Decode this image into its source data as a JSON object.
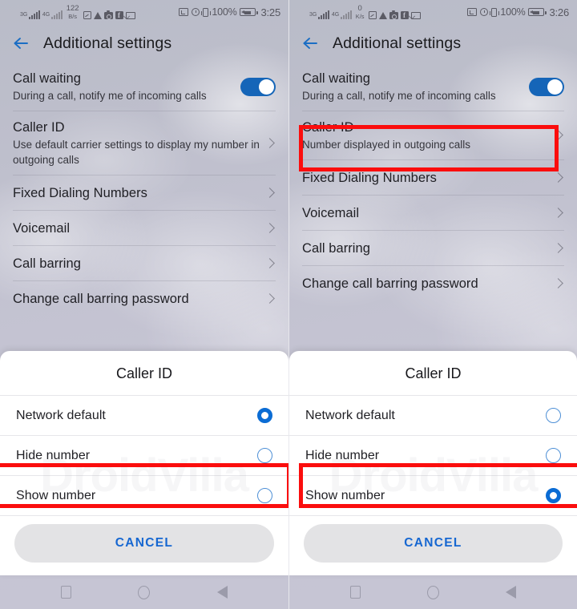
{
  "panels": [
    {
      "id": "left",
      "status_bar": {
        "signal1_gen": "3G",
        "signal2_gen": "4G",
        "net_speed_value": "122",
        "net_speed_unit": "B/s",
        "icons": [
          "screenshot-icon",
          "drive-icon",
          "camera-icon",
          "facebook-icon",
          "mail-icon"
        ],
        "cast_icon": "cast-icon",
        "alarm_icon": "alarm-icon",
        "vibrate_icon": "vibrate-icon",
        "battery_percent": "100%",
        "battery_icon": "battery-charging-icon",
        "clock": "3:25"
      },
      "appbar": {
        "back_icon": "back-arrow-icon",
        "title": "Additional settings"
      },
      "settings": [
        {
          "title": "Call waiting",
          "subtitle": "During a call, notify me of incoming calls",
          "control": "toggle",
          "toggle_on": true
        },
        {
          "title": "Caller ID",
          "subtitle": "Use default carrier settings to display my number in outgoing calls",
          "control": "chevron",
          "highlighted": false
        },
        {
          "title": "Fixed Dialing Numbers",
          "subtitle": "",
          "control": "chevron"
        },
        {
          "title": "Voicemail",
          "subtitle": "",
          "control": "chevron"
        },
        {
          "title": "Call barring",
          "subtitle": "",
          "control": "chevron"
        },
        {
          "title": "Change call barring password",
          "subtitle": "",
          "control": "chevron"
        }
      ],
      "dialog": {
        "title": "Caller ID",
        "options": [
          {
            "label": "Network default",
            "selected": true
          },
          {
            "label": "Hide number",
            "selected": false
          },
          {
            "label": "Show number",
            "selected": false
          }
        ],
        "cancel_label": "CANCEL",
        "highlight_option_index": 2
      },
      "watermark": "DroidVilla",
      "navbar": {
        "recents_icon": "square-recents-icon",
        "home_icon": "circle-home-icon",
        "back_icon": "triangle-back-icon"
      }
    },
    {
      "id": "right",
      "status_bar": {
        "signal1_gen": "3G",
        "signal2_gen": "4G",
        "net_speed_value": "0",
        "net_speed_unit": "K/s",
        "icons": [
          "screenshot-icon",
          "drive-icon",
          "camera-icon",
          "facebook-icon",
          "mail-icon"
        ],
        "cast_icon": "cast-icon",
        "alarm_icon": "alarm-icon",
        "vibrate_icon": "vibrate-icon",
        "battery_percent": "100%",
        "battery_icon": "battery-charging-icon",
        "clock": "3:26"
      },
      "appbar": {
        "back_icon": "back-arrow-icon",
        "title": "Additional settings"
      },
      "settings": [
        {
          "title": "Call waiting",
          "subtitle": "During a call, notify me of incoming calls",
          "control": "toggle",
          "toggle_on": true
        },
        {
          "title": "Caller ID",
          "subtitle": "Number displayed in outgoing calls",
          "control": "chevron",
          "highlighted": true
        },
        {
          "title": "Fixed Dialing Numbers",
          "subtitle": "",
          "control": "chevron"
        },
        {
          "title": "Voicemail",
          "subtitle": "",
          "control": "chevron"
        },
        {
          "title": "Call barring",
          "subtitle": "",
          "control": "chevron"
        },
        {
          "title": "Change call barring password",
          "subtitle": "",
          "control": "chevron"
        }
      ],
      "dialog": {
        "title": "Caller ID",
        "options": [
          {
            "label": "Network default",
            "selected": false
          },
          {
            "label": "Hide number",
            "selected": false
          },
          {
            "label": "Show number",
            "selected": true
          }
        ],
        "cancel_label": "CANCEL",
        "highlight_option_index": 2
      },
      "watermark": "DroidVilla",
      "navbar": {
        "recents_icon": "square-recents-icon",
        "home_icon": "circle-home-icon",
        "back_icon": "triangle-back-icon"
      }
    }
  ],
  "colors": {
    "accent_blue": "#1565b8",
    "radio_selected": "#0b6cd4",
    "highlight_red": "#fb0d0d",
    "cancel_text": "#1667d1",
    "sheet_bg": "#ffffff"
  }
}
